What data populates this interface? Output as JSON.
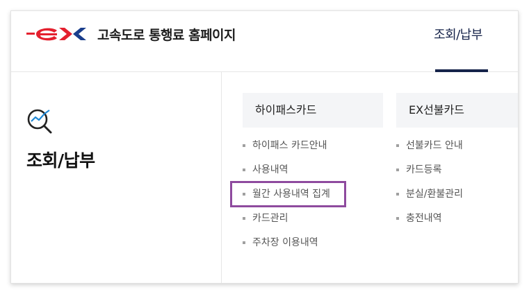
{
  "header": {
    "logo_text": "ex",
    "site_title": "고속도로 통행료 홈페이지",
    "nav_tab": "조회/납부"
  },
  "left_panel": {
    "icon": "search-graph-icon",
    "title": "조회/납부"
  },
  "menu": {
    "columns": [
      {
        "heading": "하이패스카드",
        "items": [
          "하이패스 카드안내",
          "사용내역",
          "월간 사용내역 집계",
          "카드관리",
          "주차장 이용내역"
        ]
      },
      {
        "heading": "EX선불카드",
        "items": [
          "선불카드 안내",
          "카드등록",
          "분실/환불관리",
          "충전내역"
        ]
      }
    ],
    "highlighted_item": "월간 사용내역 집계"
  },
  "colors": {
    "logo_red": "#e4202e",
    "logo_blue": "#1a3e8c",
    "nav_accent": "#16234a",
    "highlight": "#8e4a9e"
  }
}
